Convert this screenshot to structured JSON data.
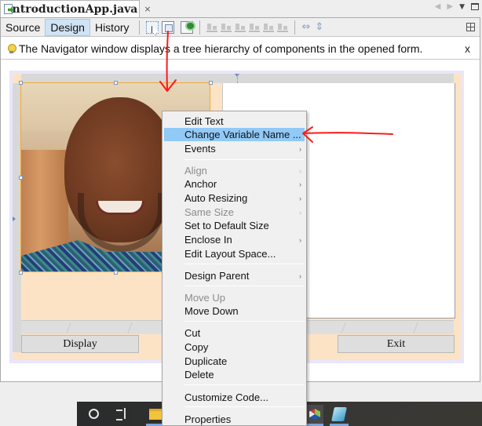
{
  "editor_tab": {
    "filename": "IntroductionApp.java",
    "close_glyph": "×"
  },
  "window_controls": {
    "prev": "◀",
    "next": "▶",
    "dropdown": "▼"
  },
  "toolbar": {
    "views": [
      "Source",
      "Design",
      "History"
    ],
    "active_view": "Design",
    "resize_h_glyph": "⇔",
    "resize_v_glyph": "⇕"
  },
  "hint": {
    "text": "The Navigator window displays a tree hierarchy of components in the opened form.",
    "close": "x"
  },
  "form": {
    "buttons": {
      "display": "Display",
      "exit": "Exit"
    },
    "photo_label": "portrait photo"
  },
  "context_menu": {
    "items": [
      {
        "label": "Edit Text",
        "enabled": true,
        "submenu": false
      },
      {
        "label": "Change Variable Name ...",
        "enabled": true,
        "submenu": false,
        "highlighted": true
      },
      {
        "label": "Events",
        "enabled": true,
        "submenu": true
      },
      {
        "label": "Align",
        "enabled": false,
        "submenu": true
      },
      {
        "label": "Anchor",
        "enabled": true,
        "submenu": true
      },
      {
        "label": "Auto Resizing",
        "enabled": true,
        "submenu": true
      },
      {
        "label": "Same Size",
        "enabled": false,
        "submenu": true
      },
      {
        "label": "Set to Default Size",
        "enabled": true,
        "submenu": false
      },
      {
        "label": "Enclose In",
        "enabled": true,
        "submenu": true
      },
      {
        "label": "Edit Layout Space...",
        "enabled": true,
        "submenu": false
      },
      {
        "label": "Design Parent",
        "enabled": true,
        "submenu": true
      },
      {
        "label": "Move Up",
        "enabled": false,
        "submenu": false
      },
      {
        "label": "Move Down",
        "enabled": true,
        "submenu": false
      },
      {
        "label": "Cut",
        "enabled": true,
        "submenu": false
      },
      {
        "label": "Copy",
        "enabled": true,
        "submenu": false
      },
      {
        "label": "Duplicate",
        "enabled": true,
        "submenu": false
      },
      {
        "label": "Delete",
        "enabled": true,
        "submenu": false
      },
      {
        "label": "Customize Code...",
        "enabled": true,
        "submenu": false
      },
      {
        "label": "Properties",
        "enabled": true,
        "submenu": false
      }
    ],
    "submenu_glyph": "›"
  },
  "taskbar": {
    "apps": [
      "cortana-search",
      "task-view",
      "file-explorer",
      "netbeans",
      "notepad"
    ]
  },
  "colors": {
    "highlight": "#91c9f7",
    "form_background": "#fde3c6",
    "annotation_red": "#ff0000",
    "selection_border": "#f0a733"
  }
}
